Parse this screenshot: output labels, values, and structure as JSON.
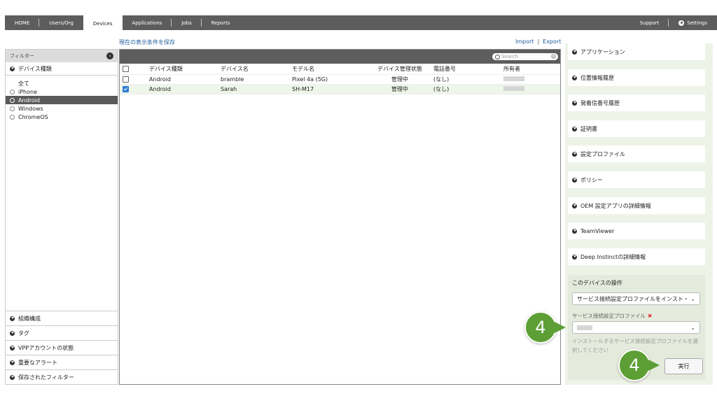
{
  "nav": {
    "left": [
      "HOME",
      "Users/Org",
      "Devices",
      "Applications",
      "Jobs",
      "Reports"
    ],
    "active": "Devices",
    "support": "Support",
    "settings": "Settings"
  },
  "toplinks": {
    "save_filter": "現在の表示条件を保存",
    "import": "Import",
    "export": "Export",
    "sep": "|"
  },
  "filter": {
    "title": "フィルター",
    "device_type_header": "デバイス種類",
    "device_types": [
      "全て",
      "iPhone",
      "Android",
      "Windows",
      "ChromeOS"
    ],
    "selected": "Android",
    "bottom_sections": [
      "組織構成",
      "タグ",
      "VPPアカウントの状態",
      "重要なアラート",
      "保存されたフィルター"
    ]
  },
  "table": {
    "search_placeholder": "Search",
    "columns": [
      "デバイス種類",
      "デバイス名",
      "モデル名",
      "デバイス管理状態",
      "電話番号",
      "所有者"
    ],
    "rows": [
      {
        "checked": false,
        "type": "Android",
        "name": "bramble",
        "model": "Pixel 4a (5G)",
        "status": "管理中",
        "phone": "(なし)"
      },
      {
        "checked": true,
        "type": "Android",
        "name": "Sarah",
        "model": "SH-M17",
        "status": "管理中",
        "phone": "(なし)"
      }
    ]
  },
  "right_panel": {
    "sections": [
      "アプリケーション",
      "位置情報履歴",
      "発着信番号履歴",
      "証明書",
      "設定プロファイル",
      "ポリシー",
      "OEM 設定アプリの詳細情報",
      "TeamViewer",
      "Deep Instinctの詳細情報"
    ],
    "ops_title": "このデバイスの操作",
    "operation_value": "サービス接続設定プロファイルをインスト・",
    "profile_label": "サービス接続設定プロファイル",
    "required_mark": "✖",
    "help_text": "インストールするサービス接続設定プロファイルを選択してください",
    "execute": "実行"
  },
  "callouts": [
    "4",
    "4"
  ]
}
